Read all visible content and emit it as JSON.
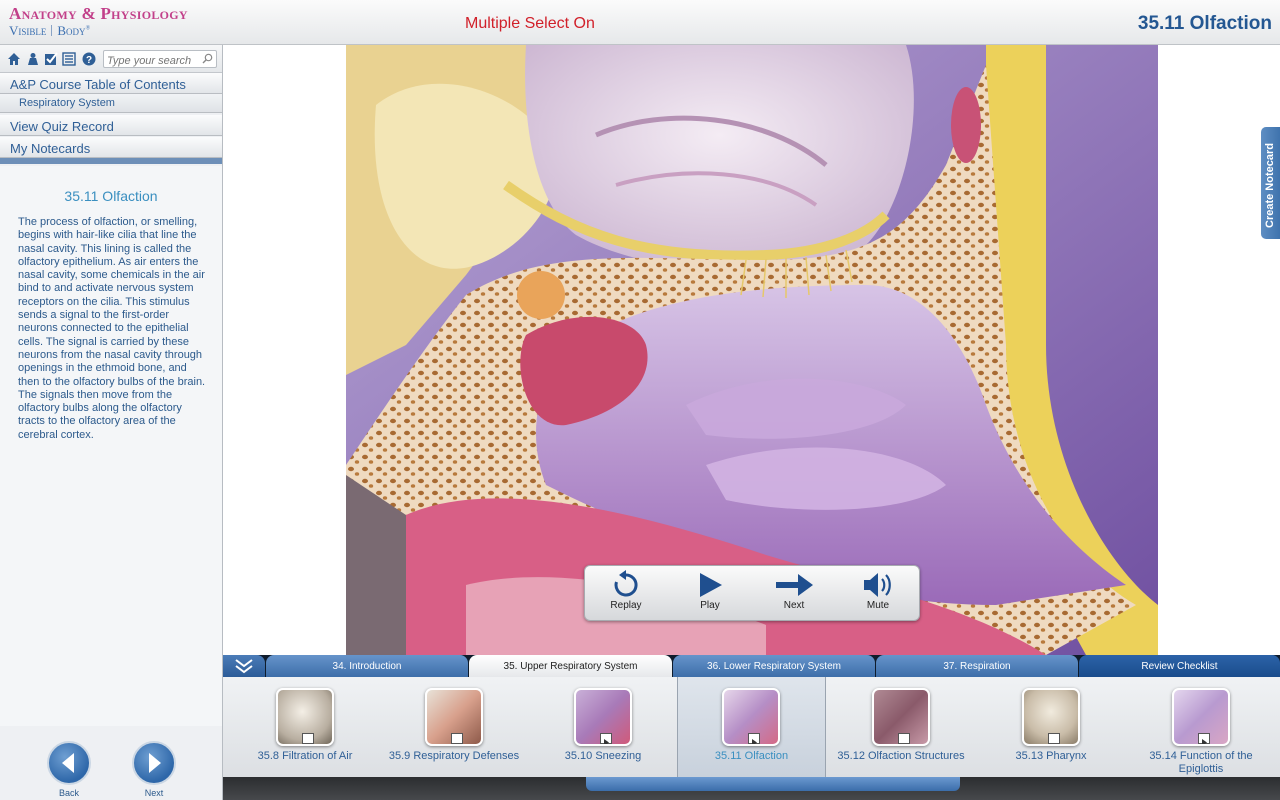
{
  "header": {
    "logo_line1": "Anatomy & Physiology",
    "logo_visible": "Visible",
    "logo_body": "Body",
    "multi_select": "Multiple Select On",
    "page_heading": "35.11 Olfaction"
  },
  "sidebar": {
    "toolbar_icons": [
      "home-icon",
      "person-icon",
      "checkbox-icon",
      "list-icon",
      "help-icon"
    ],
    "search_placeholder": "Type your search",
    "nav": {
      "toc": "A&P Course Table of Contents",
      "respiratory": "Respiratory System",
      "quiz": "View Quiz Record",
      "notecards": "My Notecards"
    },
    "content": {
      "title": "35.11 Olfaction",
      "body": "The process of olfaction, or smelling, begins with hair-like cilia that line the nasal cavity. This lining is called the olfactory epithelium. As air enters the nasal cavity, some chemicals in the air bind to and activate nervous system receptors on the cilia. This stimulus sends a signal to the first-order neurons connected to the epithelial cells. The signal is carried by these neurons from the nasal cavity through openings in the ethmoid bone, and then to the olfactory bulbs of the brain. The signals then move from the olfactory bulbs along the olfactory tracts to the olfactory area of the cerebral cortex."
    },
    "back_label": "Back",
    "next_label": "Next"
  },
  "create_notecard": "Create Notecard",
  "media": {
    "replay": "Replay",
    "play": "Play",
    "next": "Next",
    "mute": "Mute"
  },
  "tabs": [
    {
      "label": "34. Introduction",
      "state": "normal"
    },
    {
      "label": "35. Upper Respiratory System",
      "state": "active"
    },
    {
      "label": "36. Lower Respiratory System",
      "state": "normal"
    },
    {
      "label": "37. Respiration",
      "state": "normal"
    },
    {
      "label": "Review Checklist",
      "state": "review"
    }
  ],
  "thumbnails": [
    {
      "caption": "35.8 Filtration of Air",
      "icon": "3d-model-icon"
    },
    {
      "caption": "35.9 Respiratory Defenses",
      "icon": "3d-model-icon"
    },
    {
      "caption": "35.10 Sneezing",
      "icon": "video-icon"
    },
    {
      "caption": "35.11 Olfaction",
      "icon": "video-icon",
      "active": true
    },
    {
      "caption": "35.12 Olfaction Structures",
      "icon": "3d-model-icon"
    },
    {
      "caption": "35.13 Pharynx",
      "icon": "3d-model-icon"
    },
    {
      "caption": "35.14 Function of the Epiglottis",
      "icon": "video-icon"
    }
  ],
  "colors": {
    "accent_blue": "#2f5f96",
    "heading_blue": "#245792",
    "alert_red": "#d1202a",
    "logo_pink": "#c2408a"
  }
}
